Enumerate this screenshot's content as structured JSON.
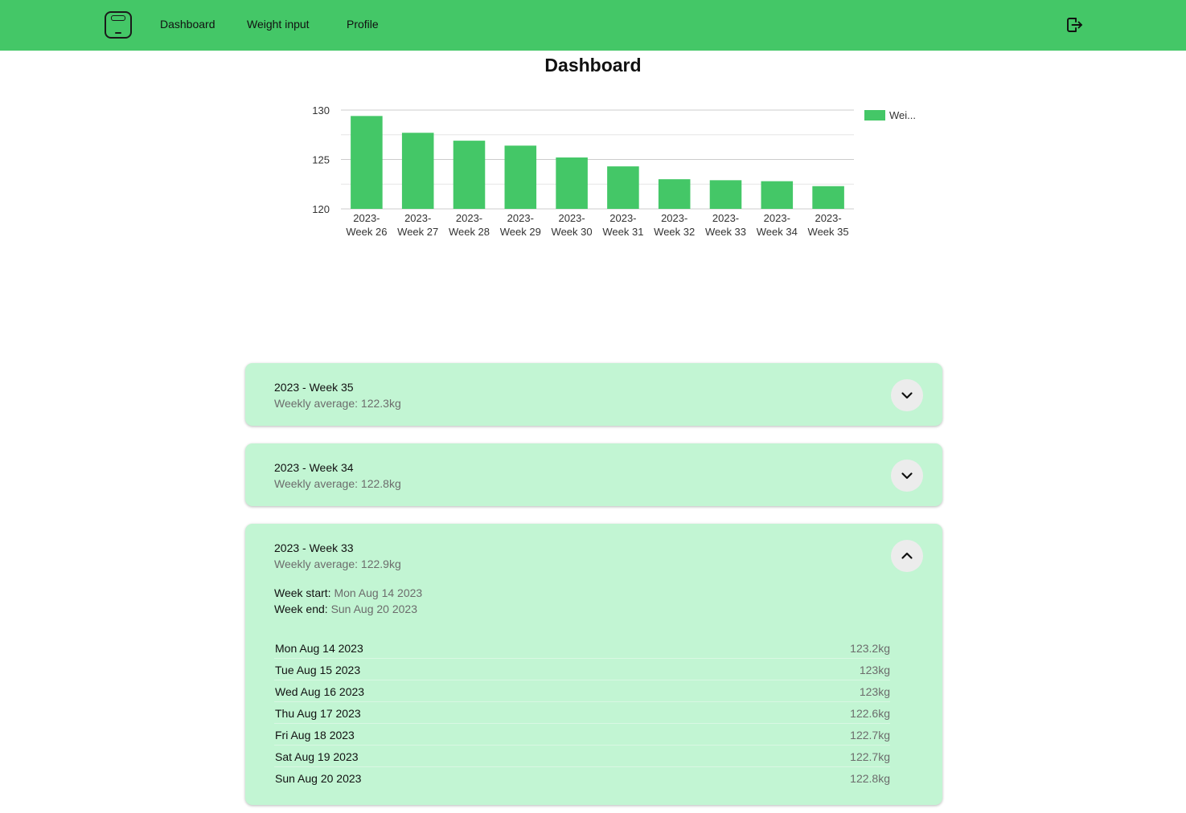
{
  "nav": {
    "links": [
      "Dashboard",
      "Weight input",
      "Profile"
    ],
    "logo_icon": "scale-icon",
    "logout_icon": "logout-icon"
  },
  "page": {
    "title": "Dashboard"
  },
  "colors": {
    "brand": "#44c767",
    "card_background": "#c2f5d3",
    "toggle_background": "#ececec"
  },
  "chart_data": {
    "type": "bar",
    "categories": [
      [
        "2023-",
        "Week 26"
      ],
      [
        "2023-",
        "Week 27"
      ],
      [
        "2023-",
        "Week 28"
      ],
      [
        "2023-",
        "Week 29"
      ],
      [
        "2023-",
        "Week 30"
      ],
      [
        "2023-",
        "Week 31"
      ],
      [
        "2023-",
        "Week 32"
      ],
      [
        "2023-",
        "Week 33"
      ],
      [
        "2023-",
        "Week 34"
      ],
      [
        "2023-",
        "Week 35"
      ]
    ],
    "series": [
      {
        "name": "Wei...",
        "color": "#44c767",
        "values": [
          129.4,
          127.7,
          126.9,
          126.4,
          125.2,
          124.3,
          123.0,
          122.9,
          122.8,
          122.3
        ]
      }
    ],
    "y_ticks": [
      120,
      125,
      130
    ],
    "ylim": [
      120,
      130
    ],
    "grid": true,
    "legend_position": "top-right"
  },
  "weeks": [
    {
      "title": "2023 - Week 35",
      "average": "Weekly average: 122.3kg",
      "expanded": false,
      "toggle_icon": "chevron-down-icon"
    },
    {
      "title": "2023 - Week 34",
      "average": "Weekly average: 122.8kg",
      "expanded": false,
      "toggle_icon": "chevron-down-icon"
    },
    {
      "title": "2023 - Week 33",
      "average": "Weekly average: 122.9kg",
      "expanded": true,
      "toggle_icon": "chevron-up-icon",
      "week_start_label": "Week start:",
      "week_start": "Mon Aug 14 2023",
      "week_end_label": "Week end:",
      "week_end": "Sun Aug 20 2023",
      "days": [
        {
          "date": "Mon Aug 14 2023",
          "weight": "123.2kg"
        },
        {
          "date": "Tue Aug 15 2023",
          "weight": "123kg"
        },
        {
          "date": "Wed Aug 16 2023",
          "weight": "123kg"
        },
        {
          "date": "Thu Aug 17 2023",
          "weight": "122.6kg"
        },
        {
          "date": "Fri Aug 18 2023",
          "weight": "122.7kg"
        },
        {
          "date": "Sat Aug 19 2023",
          "weight": "122.7kg"
        },
        {
          "date": "Sun Aug 20 2023",
          "weight": "122.8kg"
        }
      ]
    }
  ]
}
